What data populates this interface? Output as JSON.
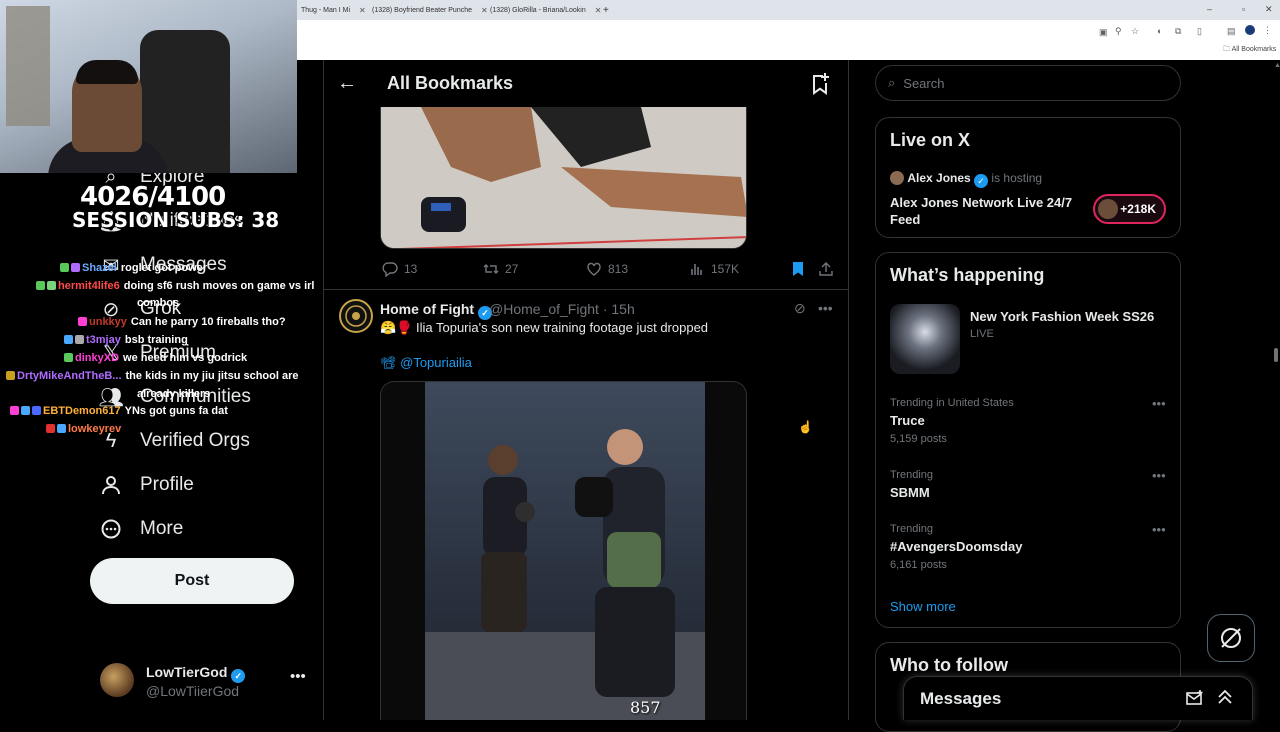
{
  "browser": {
    "tabs": [
      {
        "label": "Thug - Man I Mi"
      },
      {
        "label": "(1328) Boyfriend Beater Punche"
      },
      {
        "label": "(1328) GloRilla - Briana/Lookin"
      }
    ],
    "new_tab": "+",
    "bookmark_folder": "All Bookmarks",
    "window_controls": [
      "–",
      "▫",
      "✕"
    ]
  },
  "stream": {
    "sub_count": "4026/4100",
    "session_subs": "SESSION SUBS: 38",
    "chat": [
      {
        "user": "Shazel",
        "message": "roglet got power",
        "color": "#6aa8ff"
      },
      {
        "user": "hermit4life6",
        "message": "doing sf6 rush moves on game vs irl",
        "color": "#ff4a4a"
      },
      {
        "user": "",
        "message": "combos",
        "color": "#ffffff"
      },
      {
        "user": "unkkyy",
        "message": "Can he parry 10 fireballs tho?",
        "color": "#c0392b"
      },
      {
        "user": "t3mjay",
        "message": "bsb training",
        "color": "#b06cff"
      },
      {
        "user": "dinkyXD",
        "message": "we need him vs godrick",
        "color": "#ff3fd5"
      },
      {
        "user": "DrtyMikeAndTheB...",
        "message": "the kids in my jiu jitsu school are",
        "color": "#b06cff"
      },
      {
        "user": "",
        "message": "already killers",
        "color": "#ffffff"
      },
      {
        "user": "EBTDemon617",
        "message": "YNs got guns fa dat",
        "color": "#ffb13b"
      },
      {
        "user": "lowkeyrev",
        "message": "",
        "color": "#ff7a4a"
      }
    ]
  },
  "nav": {
    "items": [
      {
        "label": "Explore",
        "icon": "search-icon"
      },
      {
        "label": "Notifications",
        "icon": "bell-icon"
      },
      {
        "label": "Messages",
        "icon": "mail-icon"
      },
      {
        "label": "Grok",
        "icon": "grok-icon"
      },
      {
        "label": "Premium",
        "icon": "x-logo-icon"
      },
      {
        "label": "Communities",
        "icon": "communities-icon"
      },
      {
        "label": "Verified Orgs",
        "icon": "lightning-icon"
      },
      {
        "label": "Profile",
        "icon": "person-icon"
      },
      {
        "label": "More",
        "icon": "more-circle-icon"
      }
    ],
    "post_button": "Post",
    "account": {
      "name": "LowTierGod",
      "handle": "@LowTiierGod"
    }
  },
  "main": {
    "title": "All Bookmarks",
    "post1": {
      "replies": "13",
      "reposts": "27",
      "likes": "813",
      "views": "157K"
    },
    "post2": {
      "author": "Home of Fight",
      "meta": "@Home_of_Fight · 15h",
      "text": "😤🥊 Ilia Topuria's son new training footage just dropped",
      "mention": "📽 @Topuriailia",
      "video_views": "857"
    }
  },
  "sidebar": {
    "search_placeholder": "Search",
    "live": {
      "title": "Live on X",
      "host": "Alex Jones",
      "hosting_text": "is hosting",
      "stream_title": "Alex Jones Network Live 24/7 Feed",
      "listeners": "+218K"
    },
    "happening": {
      "title": "What’s happening",
      "event_title": "New York Fashion Week SS26",
      "event_status": "LIVE",
      "trends": [
        {
          "category": "Trending in United States",
          "name": "Truce",
          "count": "5,159 posts"
        },
        {
          "category": "Trending",
          "name": "SBMM",
          "count": ""
        },
        {
          "category": "Trending",
          "name": "#AvengersDoomsday",
          "count": "6,161 posts"
        }
      ],
      "show_more": "Show more"
    },
    "who_to_follow": "Who to follow",
    "messages": "Messages"
  },
  "colors": {
    "accent": "#1d9bf0",
    "background": "#000000",
    "border": "#2f3336",
    "muted": "#71767b"
  }
}
